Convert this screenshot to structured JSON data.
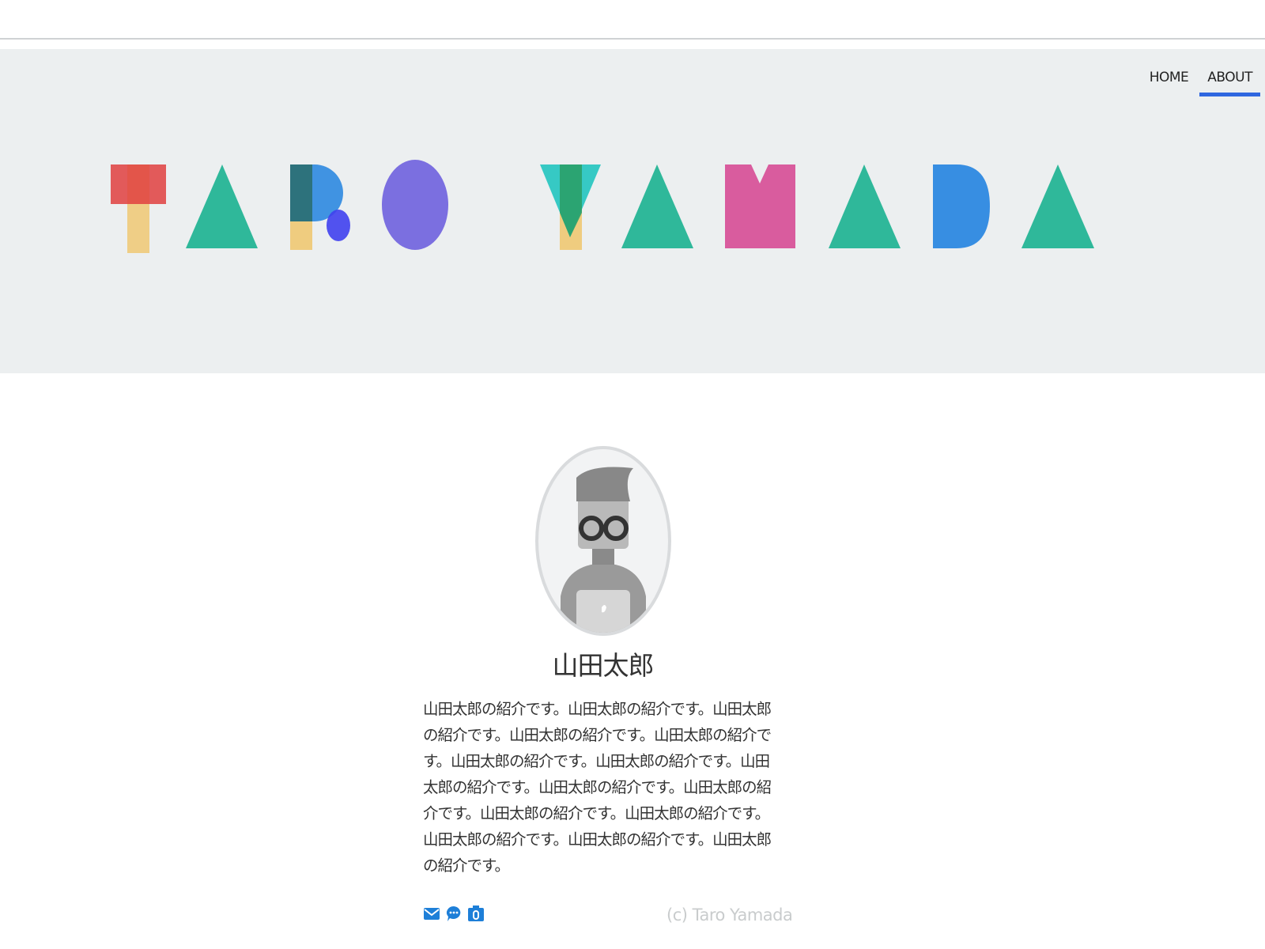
{
  "nav": {
    "home_label": "HOME",
    "about_label": "ABOUT",
    "active_color": "#2f67e0"
  },
  "hero": {
    "logo_text": "TARO YAMADA",
    "background": "#eceff0"
  },
  "profile": {
    "name": "山田太郎",
    "bio": "山田太郎の紹介です。山田太郎の紹介です。山田太郎の紹介です。山田太郎の紹介です。山田太郎の紹介です。山田太郎の紹介です。山田太郎の紹介です。山田太郎の紹介です。山田太郎の紹介です。山田太郎の紹介です。山田太郎の紹介です。山田太郎の紹介です。山田太郎の紹介です。山田太郎の紹介です。山田太郎の紹介です。"
  },
  "footer": {
    "icons": [
      "mail-icon",
      "chat-icon",
      "camera-icon"
    ],
    "icon_color": "#1e7fd8",
    "copyright": "(c) Taro Yamada"
  }
}
